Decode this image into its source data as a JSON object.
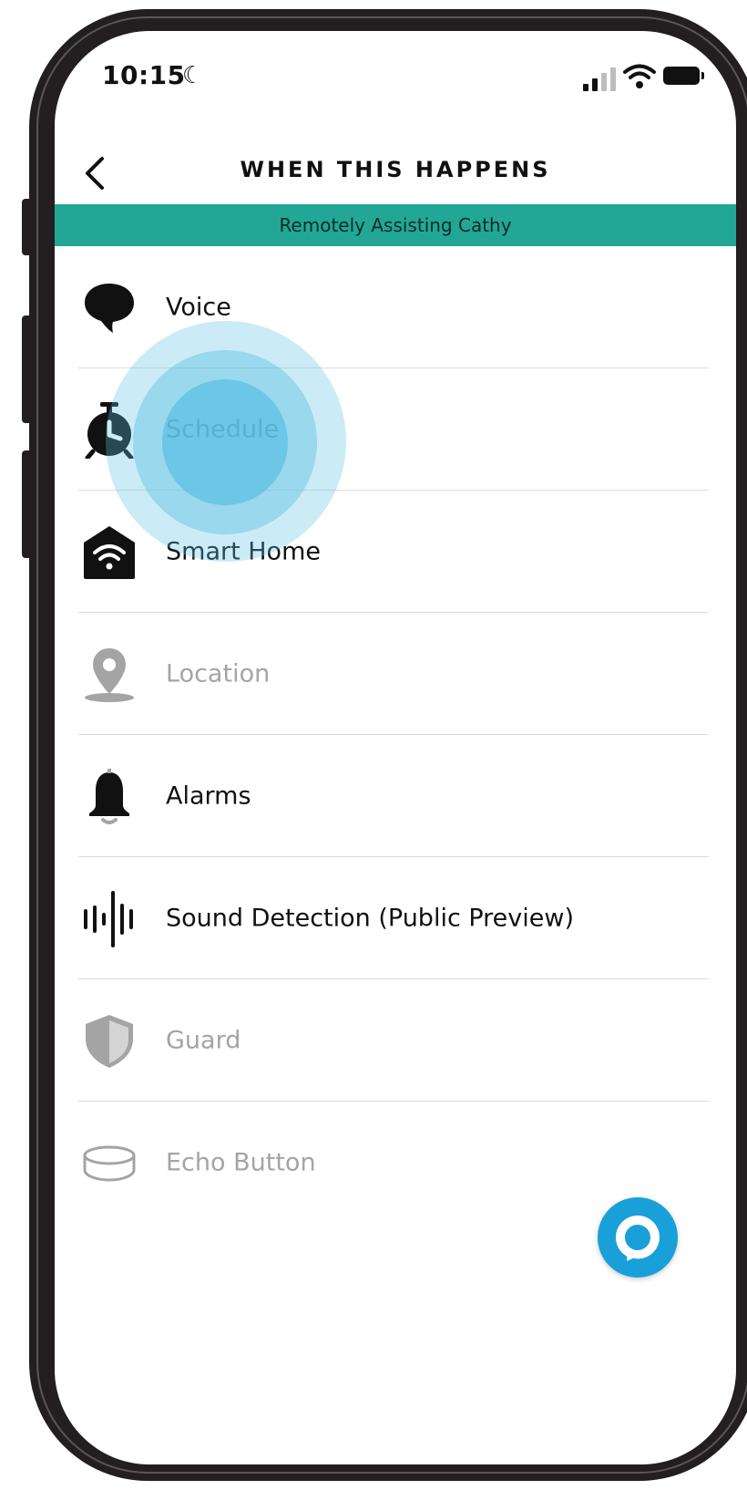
{
  "status_bar": {
    "time": "10:15"
  },
  "header": {
    "title": "WHEN THIS HAPPENS"
  },
  "banner": {
    "text": "Remotely Assisting Cathy",
    "color": "#22a797"
  },
  "triggers": [
    {
      "label": "Voice",
      "icon": "speech-bubble-icon",
      "enabled": true
    },
    {
      "label": "Schedule",
      "icon": "alarm-clock-icon",
      "enabled": true,
      "highlighted": true
    },
    {
      "label": "Smart Home",
      "icon": "smart-home-icon",
      "enabled": true
    },
    {
      "label": "Location",
      "icon": "location-pin-icon",
      "enabled": false
    },
    {
      "label": "Alarms",
      "icon": "bell-icon",
      "enabled": true
    },
    {
      "label": "Sound Detection (Public Preview)",
      "icon": "sound-wave-icon",
      "enabled": true
    },
    {
      "label": "Guard",
      "icon": "shield-icon",
      "enabled": false
    },
    {
      "label": "Echo Button",
      "icon": "echo-button-icon",
      "enabled": false
    }
  ],
  "fab": {
    "icon": "alexa-icon",
    "color": "#1aa0d8"
  },
  "colors": {
    "highlight": "#5ec0e2",
    "disabled_text": "#a4a4a4"
  }
}
